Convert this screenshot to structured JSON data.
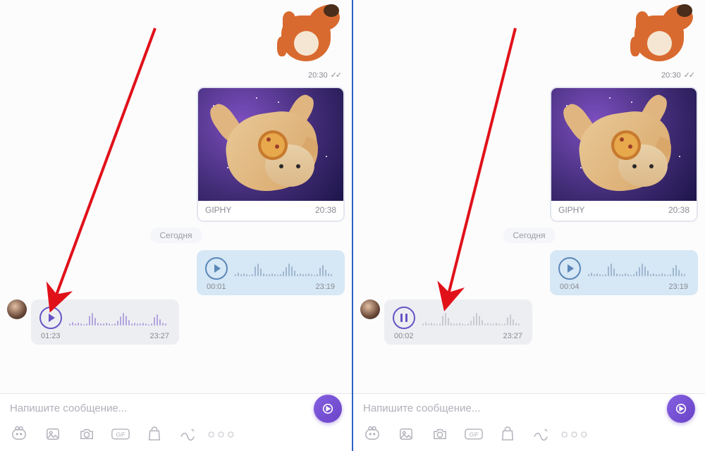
{
  "panes": [
    {
      "sticker_time": "20:30",
      "gif_label": "GIPHY",
      "gif_time": "20:38",
      "day_separator": "Сегодня",
      "voice_out": {
        "button": "play",
        "duration": "00:01",
        "time": "23:19"
      },
      "voice_in": {
        "button": "play",
        "duration": "01:23",
        "time": "23:27"
      },
      "arrow_target": "play-button"
    },
    {
      "sticker_time": "20:30",
      "gif_label": "GIPHY",
      "gif_time": "20:38",
      "day_separator": "Сегодня",
      "voice_out": {
        "button": "play",
        "duration": "00:04",
        "time": "23:19"
      },
      "voice_in": {
        "button": "pause",
        "duration": "00:02",
        "time": "23:27"
      },
      "arrow_target": "waveform"
    }
  ],
  "composer": {
    "placeholder": "Напишите сообщение..."
  },
  "icons": [
    "sticker",
    "gallery",
    "camera",
    "gif",
    "shop",
    "doodle",
    "more"
  ]
}
